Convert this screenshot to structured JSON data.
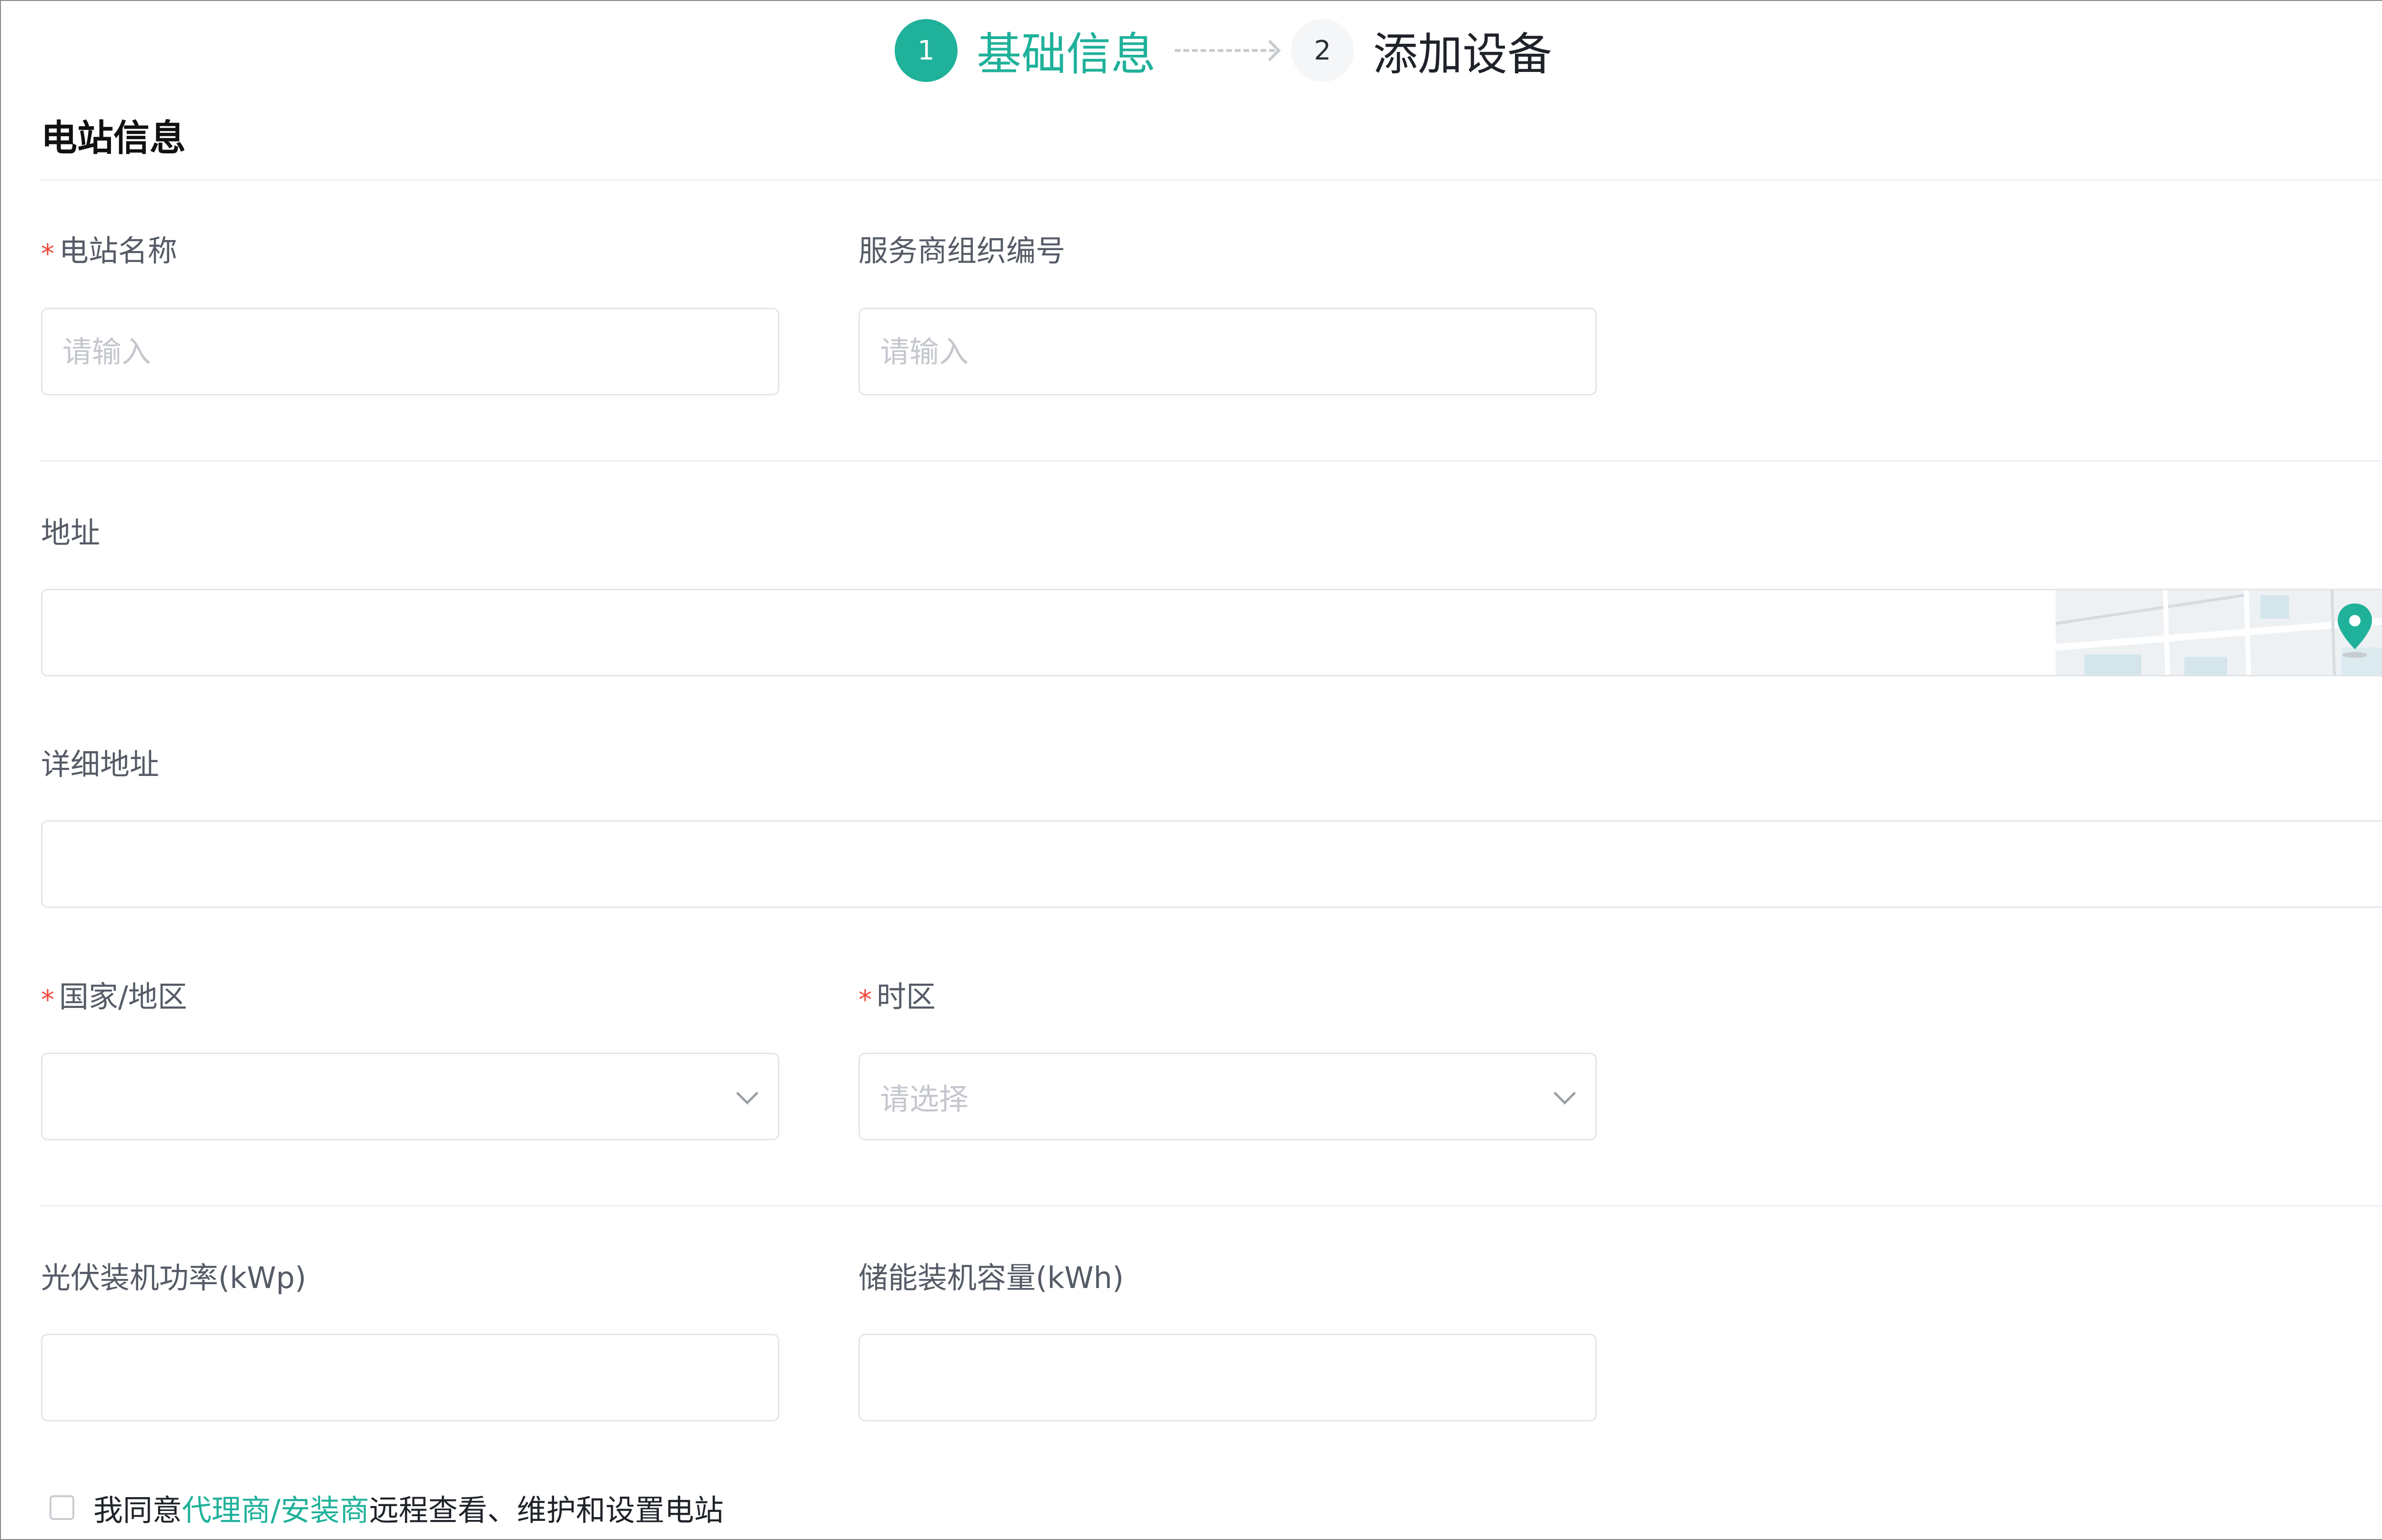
{
  "steps": [
    {
      "number": "1",
      "label": "基础信息",
      "state": "active"
    },
    {
      "number": "2",
      "label": "添加设备",
      "state": "pending"
    }
  ],
  "section_title": "电站信息",
  "fields": {
    "station_name": {
      "label": "电站名称",
      "required": true,
      "placeholder": "请输入",
      "value": ""
    },
    "service_org_no": {
      "label": "服务商组织编号",
      "required": false,
      "placeholder": "请输入",
      "value": ""
    },
    "address": {
      "label": "地址",
      "required": false,
      "value": "",
      "map_icon": "location-pin-icon"
    },
    "detail_address": {
      "label": "详细地址",
      "required": false,
      "value": ""
    },
    "country_region": {
      "label": "国家/地区",
      "required": true,
      "value": "",
      "control": "select"
    },
    "timezone": {
      "label": "时区",
      "required": true,
      "placeholder": "请选择",
      "value": "",
      "control": "select"
    },
    "pv_capacity": {
      "label": "光伏装机功率(kWp)",
      "required": false,
      "value": ""
    },
    "storage_capacity": {
      "label": "储能装机容量(kWh)",
      "required": false,
      "value": ""
    }
  },
  "agreement": {
    "checked": false,
    "prefix": "我同意",
    "link_text": "代理商/安装商",
    "suffix": "远程查看、维护和设置电站"
  },
  "required_mark": "*",
  "colors": {
    "accent": "#1fb19a",
    "required": "#f0473c",
    "border": "#e3e5e8",
    "label": "#555b66"
  }
}
